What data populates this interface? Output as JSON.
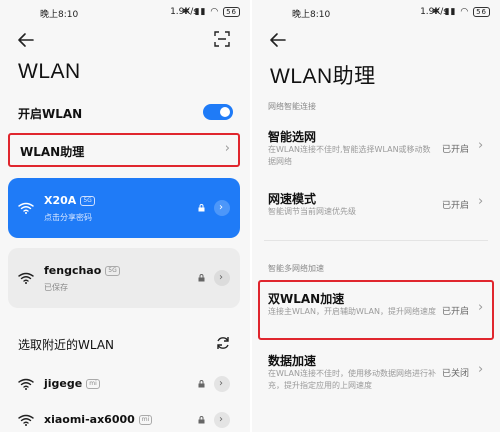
{
  "left": {
    "status": {
      "time": "晚上8:10",
      "speed": "1.9K/s",
      "battery": "56"
    },
    "title": "WLAN",
    "enable_label": "开启WLAN",
    "assistant_label": "WLAN助理",
    "connected": {
      "name": "X20A",
      "tag": "5G",
      "sub": "点击分享密码"
    },
    "saved": {
      "name": "fengchao",
      "tag": "5G",
      "sub": "已保存"
    },
    "nearby_label": "选取附近的WLAN",
    "nearby": [
      {
        "name": "jigege",
        "tag": "mi"
      },
      {
        "name": "xiaomi-ax6000",
        "tag": "mi"
      }
    ]
  },
  "right": {
    "status": {
      "time": "晚上8:10",
      "speed": "1.9K/s",
      "battery": "56"
    },
    "title": "WLAN助理",
    "section1": "网络智能连接",
    "section2": "智能多网络加速",
    "options": [
      {
        "title": "智能选网",
        "desc": "在WLAN连接不佳时,智能选择WLAN或移动数据网络",
        "status": "已开启"
      },
      {
        "title": "网速模式",
        "desc": "智能调节当前网速优先级",
        "status": "已开启"
      },
      {
        "title": "双WLAN加速",
        "desc": "连接主WLAN，开启辅助WLAN，提升网络速度",
        "status": "已开启"
      },
      {
        "title": "数据加速",
        "desc": "在WLAN连接不佳时，使用移动数据网络进行补充，提升指定应用的上网速度",
        "status": "已关闭"
      }
    ]
  },
  "colors": {
    "accent": "#1f7bf7",
    "highlight": "#e0262e",
    "card": "#ececec"
  },
  "icons": [
    "back-arrow-icon",
    "scan-icon",
    "wifi-icon",
    "lock-icon",
    "chevron-right-icon",
    "refresh-icon"
  ]
}
